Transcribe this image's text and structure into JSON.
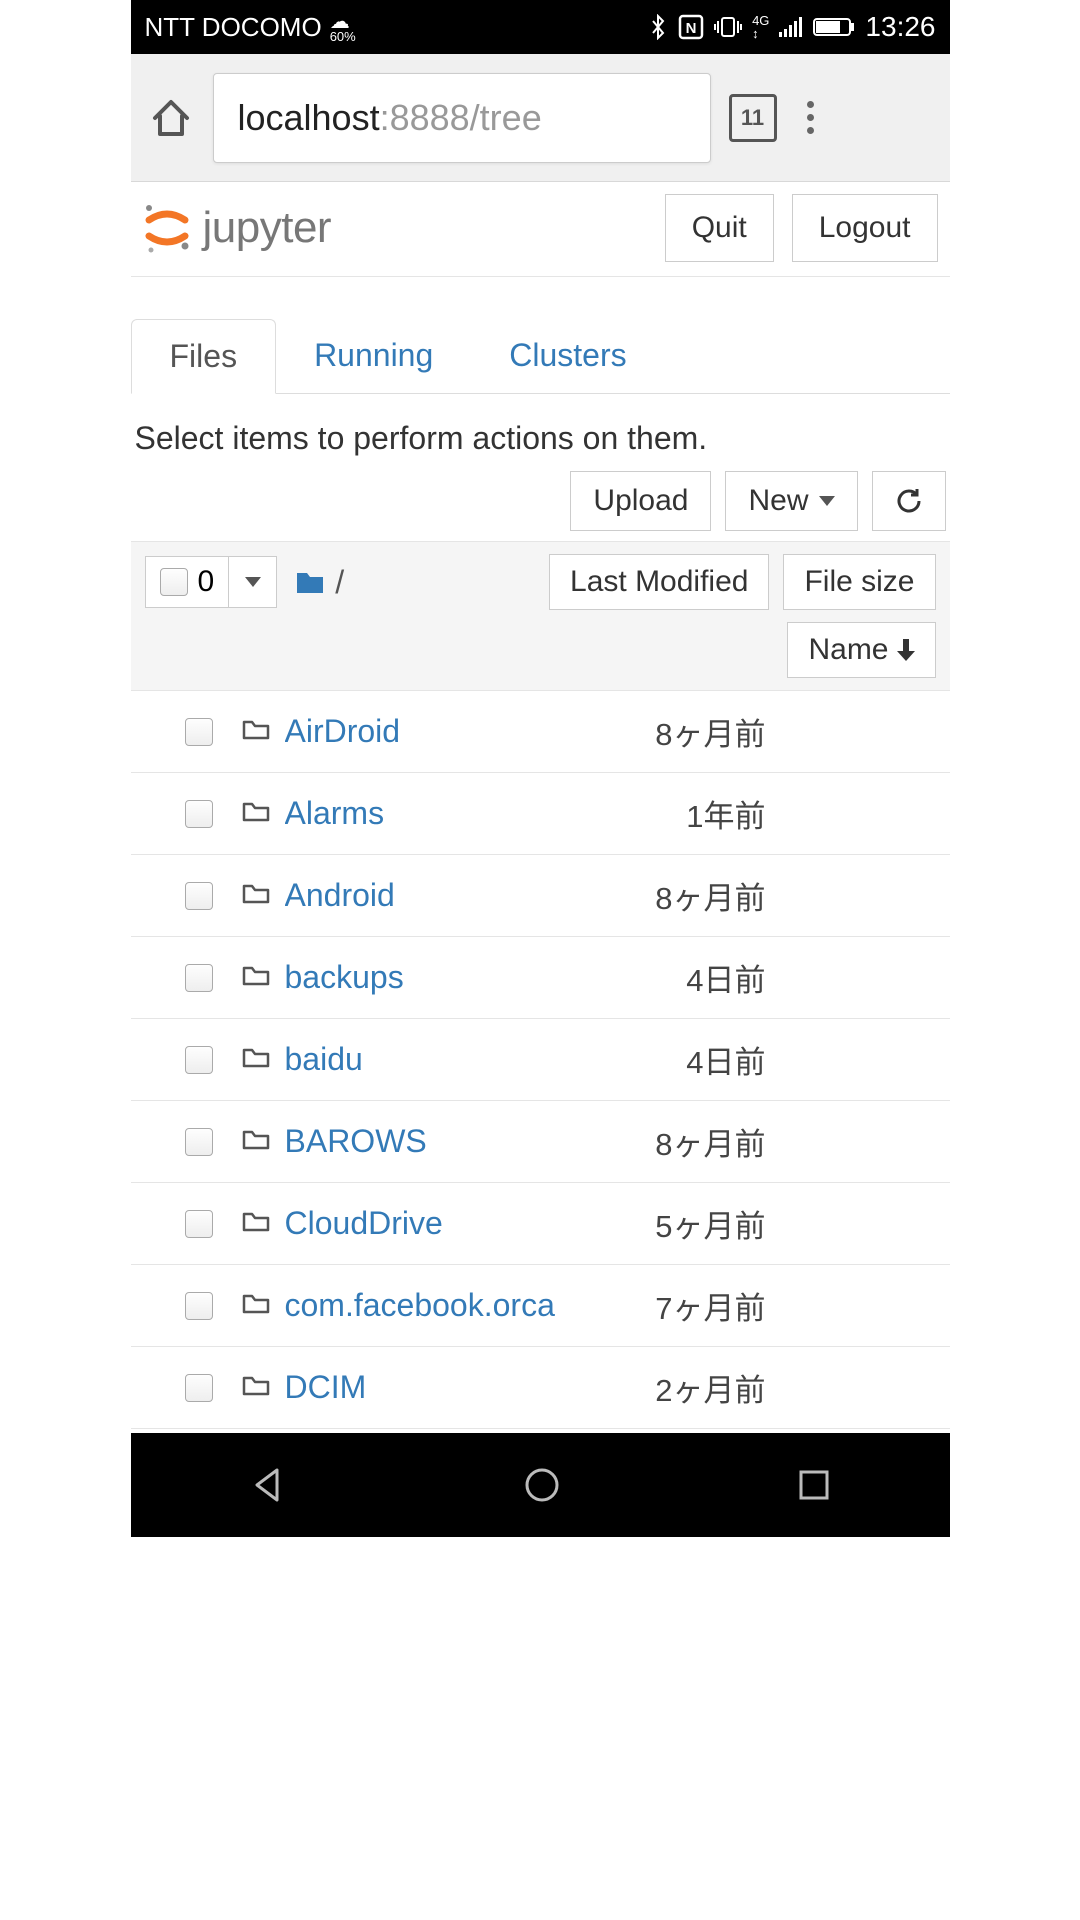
{
  "status": {
    "carrier": "NTT DOCOMO",
    "weather_pct": "60%",
    "time": "13:26"
  },
  "browser": {
    "url_host": "localhost",
    "url_path": ":8888/tree",
    "tab_count": "11"
  },
  "jupyter": {
    "logo_text": "jupyter",
    "quit": "Quit",
    "logout": "Logout",
    "tabs": [
      "Files",
      "Running",
      "Clusters"
    ],
    "hint": "Select items to perform actions on them.",
    "upload": "Upload",
    "new": "New",
    "select_count": "0",
    "breadcrumb_root": "/",
    "sort_last_modified": "Last Modified",
    "sort_file_size": "File size",
    "sort_name": "Name"
  },
  "files": [
    {
      "name": "AirDroid",
      "modified": "8ヶ月前"
    },
    {
      "name": "Alarms",
      "modified": "1年前"
    },
    {
      "name": "Android",
      "modified": "8ヶ月前"
    },
    {
      "name": "backups",
      "modified": "4日前"
    },
    {
      "name": "baidu",
      "modified": "4日前"
    },
    {
      "name": "BAROWS",
      "modified": "8ヶ月前"
    },
    {
      "name": "CloudDrive",
      "modified": "5ヶ月前"
    },
    {
      "name": "com.facebook.orca",
      "modified": "7ヶ月前"
    },
    {
      "name": "DCIM",
      "modified": "2ヶ月前"
    }
  ]
}
